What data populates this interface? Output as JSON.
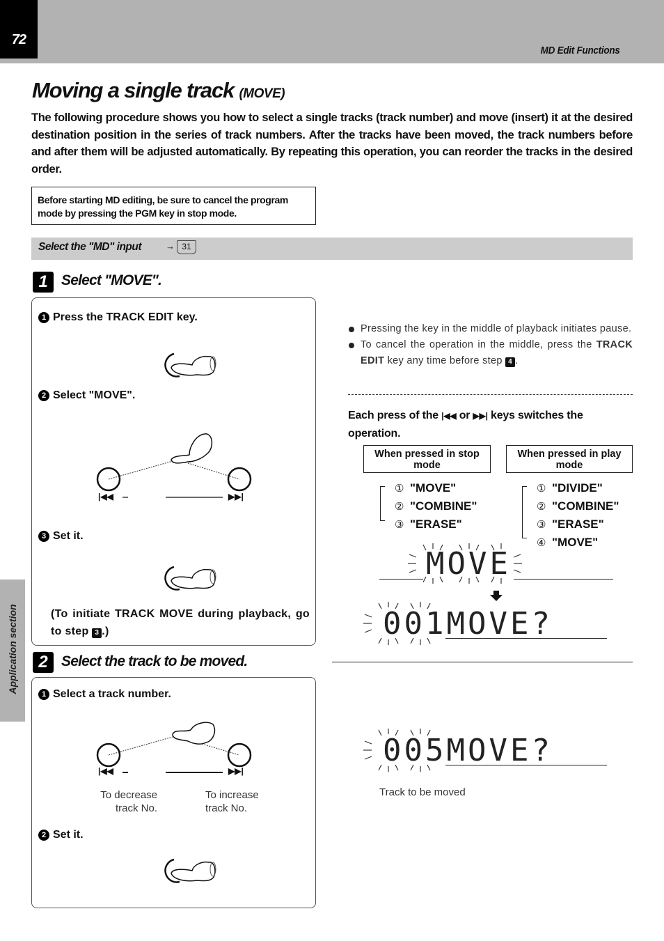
{
  "header": {
    "page_number": "72",
    "section": "MD Edit Functions"
  },
  "side_tab": {
    "label": "Application section"
  },
  "title": {
    "main": "Moving a single track",
    "sub": "(MOVE)"
  },
  "intro": "The following procedure shows you how to select a single tracks (track number) and move (insert) it at the desired destination position in the series of track numbers. After the tracks have been moved, the track numbers before and after them will be adjusted automatically. By repeating this operation, you can reorder the tracks in the desired order.",
  "note": "Before starting MD editing, be sure to cancel the program mode by pressing the PGM key in stop mode.",
  "input_bar": {
    "label": "Select the \"MD\" input",
    "arrow": "→",
    "ref_page": "31"
  },
  "step1": {
    "badge": "1",
    "heading": "Select \"MOVE\".",
    "substeps": [
      {
        "num": "1",
        "text": "Press the TRACK EDIT key."
      },
      {
        "num": "2",
        "text": "Select \"MOVE\"."
      },
      {
        "num": "3",
        "text": "Set it."
      }
    ],
    "prev_key": "|◀◀",
    "next_key": "▶▶|",
    "playback_note_pre": "(To initiate TRACK MOVE during playback, go to step ",
    "playback_note_step": "3",
    "playback_note_post": ".)"
  },
  "notes_right": {
    "bullets": [
      {
        "text": "Pressing the key in the middle of playback initiates pause."
      },
      {
        "pre": "To cancel the operation in the middle, press the ",
        "bold": "TRACK EDIT",
        "post": " key any time before step ",
        "step": "4",
        "end": "."
      }
    ],
    "each_press_pre": "Each press of the ",
    "prev_key": "|◀◀",
    "each_press_mid": " or ",
    "next_key": "▶▶|",
    "each_press_post": " keys switches the operation."
  },
  "modes": {
    "stop": {
      "label": "When pressed in stop mode",
      "items": [
        {
          "n": "①",
          "text": "\"MOVE\""
        },
        {
          "n": "②",
          "text": "\"COMBINE\""
        },
        {
          "n": "③",
          "text": "\"ERASE\""
        }
      ]
    },
    "play": {
      "label": "When pressed in play mode",
      "items": [
        {
          "n": "①",
          "text": "\"DIVIDE\""
        },
        {
          "n": "②",
          "text": "\"COMBINE\""
        },
        {
          "n": "③",
          "text": "\"ERASE\""
        },
        {
          "n": "④",
          "text": "\"MOVE\""
        }
      ]
    }
  },
  "displays": {
    "display1": "MOVE",
    "display2_num": "001",
    "display2_text": "MOVE?",
    "display3_num": "005",
    "display3_text": "MOVE?",
    "display3_caption": "Track to be moved"
  },
  "step2": {
    "badge": "2",
    "heading": "Select the track to be moved.",
    "substeps": [
      {
        "num": "1",
        "text": "Select a track number."
      },
      {
        "num": "2",
        "text": "Set it."
      }
    ],
    "prev_key": "|◀◀",
    "next_key": "▶▶|",
    "decrease_label": "To decrease track No.",
    "increase_label": "To increase track No."
  }
}
